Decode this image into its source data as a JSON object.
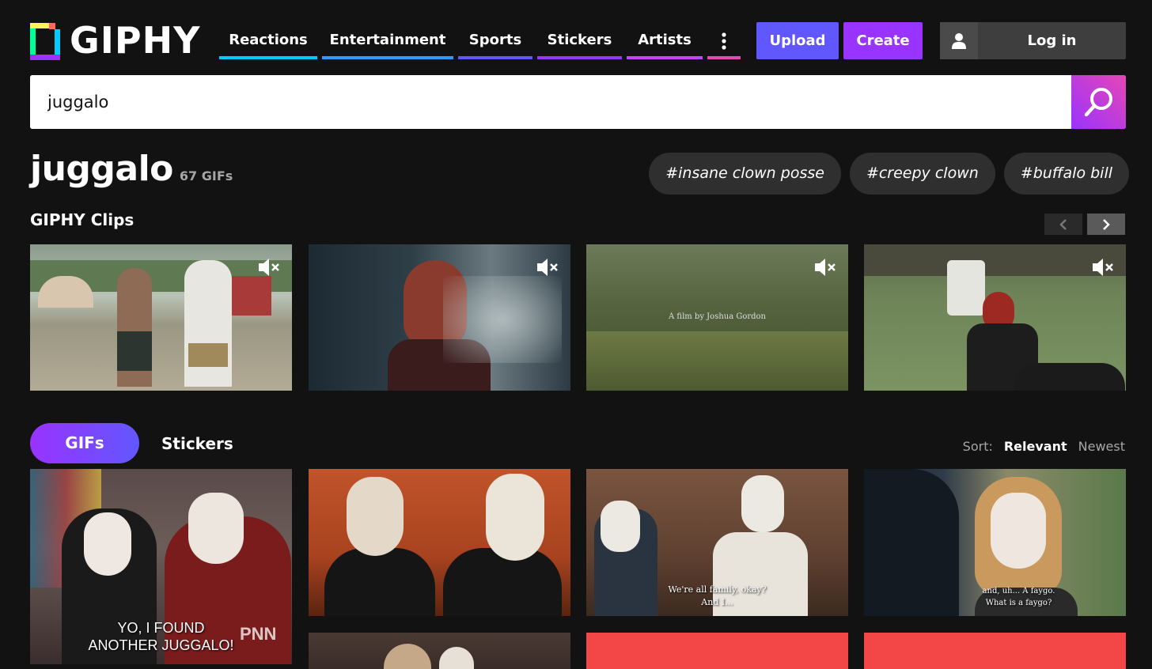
{
  "brand": {
    "name": "GIPHY"
  },
  "nav": {
    "items": [
      {
        "label": "Reactions",
        "color": "#00ccff"
      },
      {
        "label": "Entertainment",
        "color": "#3399ff"
      },
      {
        "label": "Sports",
        "color": "#6157ff"
      },
      {
        "label": "Stickers",
        "color": "#9933ff"
      },
      {
        "label": "Artists",
        "color": "#c544ff"
      }
    ],
    "more_color": "#e646b6"
  },
  "header": {
    "upload_label": "Upload",
    "create_label": "Create",
    "login_label": "Log in"
  },
  "search": {
    "value": "juggalo"
  },
  "page": {
    "title": "juggalo",
    "count": "67 GIFs"
  },
  "tags": [
    "#insane clown posse",
    "#creepy clown",
    "#buffalo bill"
  ],
  "clips_section": {
    "title": "GIPHY Clips",
    "clips": [
      {
        "caption": ""
      },
      {
        "caption": ""
      },
      {
        "caption": "A film by Joshua Gordon"
      },
      {
        "caption": ""
      }
    ]
  },
  "tabs": {
    "gifs": "GIFs",
    "stickers": "Stickers"
  },
  "sort": {
    "label": "Sort:",
    "relevant": "Relevant",
    "newest": "Newest"
  },
  "gifs": {
    "captions": [
      "YO, I FOUND\nANOTHER JUGGALO!",
      "",
      "We're all family, okay?\nAnd I...",
      "and, uh... A faygo.\nWhat is a faygo?"
    ],
    "watermark": "PNN"
  },
  "colors": {
    "upload": "#6157ff",
    "create": "#9933ff",
    "background": "#121212"
  }
}
